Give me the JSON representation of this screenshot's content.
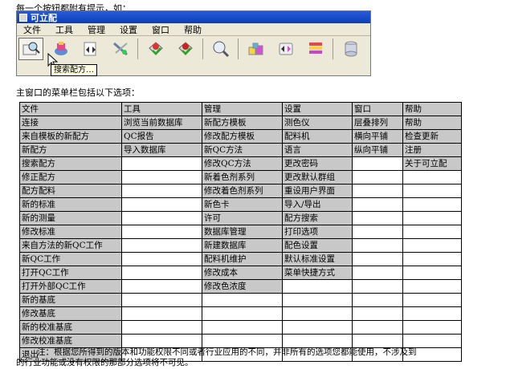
{
  "intro_text": "每一个按钮都附有提示，如：",
  "app": {
    "title": "可立配",
    "menus": [
      "文件",
      "工具",
      "管理",
      "设置",
      "窗口",
      "帮助"
    ],
    "tooltip": "搜索配方…",
    "toolbar_icons": [
      "search-recipe-icon",
      "new-recipe-icon",
      "arrow-recipe-icon",
      "tools-icon",
      "mix-icon",
      "mix-red-icon",
      "magnifier-icon",
      "paint-cans-icon",
      "arrow-swap-icon",
      "colorbars-icon",
      "cylinder-icon"
    ]
  },
  "subtitle": "主窗口的菜单栏包括以下选项：",
  "table": {
    "headers": [
      "文件",
      "工具",
      "管理",
      "设置",
      "窗口",
      "帮助"
    ],
    "rows": [
      [
        "连接",
        "浏览当前数据库",
        "新配方模板",
        "测色仪",
        "层叠排列",
        "帮助"
      ],
      [
        "来自模板的新配方",
        "QC报告",
        "修改配方模板",
        "配料机",
        "横向平铺",
        "检查更新"
      ],
      [
        "新配方",
        "导入数据库",
        "新QC方法",
        "语言",
        "纵向平铺",
        "注册"
      ],
      [
        "搜索配方",
        "",
        "修改QC方法",
        "更改密码",
        "",
        "关于可立配"
      ],
      [
        "修正配方",
        "",
        "新着色剂系列",
        "更改默认群组",
        "",
        ""
      ],
      [
        "配方配料",
        "",
        "修改着色剂系列",
        "重设用户界面",
        "",
        ""
      ],
      [
        "新的标准",
        "",
        "新色卡",
        "导入/导出",
        "",
        ""
      ],
      [
        "新的测量",
        "",
        "许可",
        "配方搜索",
        "",
        ""
      ],
      [
        "修改标准",
        "",
        "数据库管理",
        "打印选项",
        "",
        ""
      ],
      [
        "来自方法的新QC工作",
        "",
        "新建数据库",
        "配色设置",
        "",
        ""
      ],
      [
        "新QC工作",
        "",
        "配料机维护",
        "默认标准设置",
        "",
        ""
      ],
      [
        "打开QC工作",
        "",
        "修改成本",
        "菜单快捷方式",
        "",
        ""
      ],
      [
        "打开外部QC工作",
        "",
        "修改色浓度",
        "",
        "",
        ""
      ],
      [
        "新的基底",
        "",
        "",
        "",
        "",
        ""
      ],
      [
        "修改基底",
        "",
        "",
        "",
        "",
        ""
      ],
      [
        "新的校准基底",
        "",
        "",
        "",
        "",
        ""
      ],
      [
        "修改校准基底",
        "",
        "",
        "",
        "",
        ""
      ],
      [
        "退出",
        "",
        "",
        "",
        "",
        ""
      ]
    ]
  },
  "note_line1": "注：根据您所得到的版本和功能权限不同或者行业应用的不同，并非所有的选项您都能使用，不涉及到",
  "note_line2": "的行业功能或没有权限的那部分选项将不可见。"
}
